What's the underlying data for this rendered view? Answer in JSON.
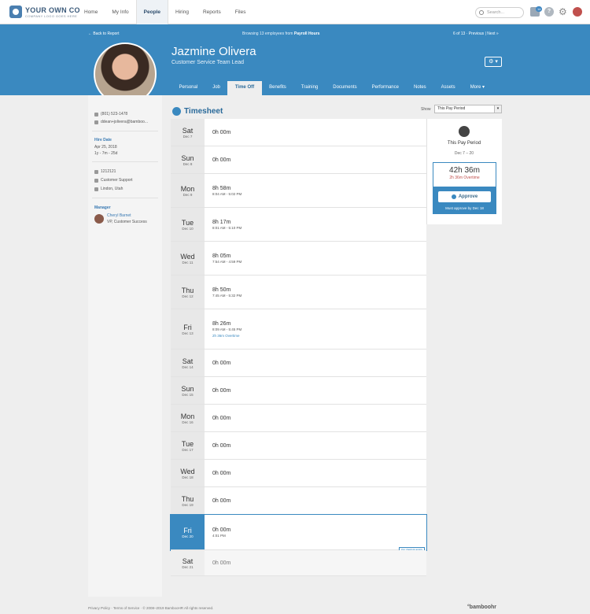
{
  "brand": {
    "name": "YOUR OWN CO",
    "tagline": "COMPANY LOGO GOES HERE"
  },
  "nav": [
    {
      "label": "Home"
    },
    {
      "label": "My Info"
    },
    {
      "label": "People",
      "active": true
    },
    {
      "label": "Hiring"
    },
    {
      "label": "Reports"
    },
    {
      "label": "Files"
    }
  ],
  "search": {
    "placeholder": "Search..."
  },
  "inbox_count": "14",
  "help_label": "?",
  "header": {
    "back": "← Back to Report",
    "browsing_prefix": "Browsing 13 employees from",
    "browsing_source": "Payroll Hours",
    "pager": "6 of 13 · Previous | Next »",
    "name": "Jazmine Olivera",
    "title": "Customer Service Team Lead"
  },
  "tabs": [
    "Personal",
    "Job",
    "Time Off",
    "Benefits",
    "Training",
    "Documents",
    "Performance",
    "Notes",
    "Assets",
    "More ▾"
  ],
  "sidebar": {
    "phone": "(801) 523-1478",
    "email": "ddean+jolivera@bamboo...",
    "hire_label": "Hire Date",
    "hire_date": "Apr 25, 2018",
    "tenure": "1y - 7m - 25d",
    "emp_id": "1212121",
    "department": "Customer Support",
    "location": "Lindon, Utah",
    "manager_label": "Manager",
    "manager_name": "Cheryl Barnet",
    "manager_title": "VP, Customer Success"
  },
  "timesheet": {
    "title": "Timesheet",
    "show_label": "Show",
    "period_select": "This Pay Period",
    "days": [
      {
        "day": "Sat",
        "date": "Dec 7",
        "hours": "0h 00m"
      },
      {
        "day": "Sun",
        "date": "Dec 8",
        "hours": "0h 00m"
      },
      {
        "day": "Mon",
        "date": "Dec 9",
        "hours": "8h 58m",
        "range": "8:04 AM - 5:02 PM"
      },
      {
        "day": "Tue",
        "date": "Dec 10",
        "hours": "8h 17m",
        "range": "8:01 AM - 5:10 PM"
      },
      {
        "day": "Wed",
        "date": "Dec 11",
        "hours": "8h 05m",
        "range": "7:54 AM - 4:59 PM"
      },
      {
        "day": "Thu",
        "date": "Dec 12",
        "hours": "8h 50m",
        "range": "7:45 AM - 5:32 PM"
      },
      {
        "day": "Fri",
        "date": "Dec 13",
        "hours": "8h 26m",
        "range": "8:09 AM - 5:45 PM",
        "overtime": "2h 36m Overtime"
      },
      {
        "day": "Sat",
        "date": "Dec 14",
        "hours": "0h 00m"
      },
      {
        "day": "Sun",
        "date": "Dec 15",
        "hours": "0h 00m"
      },
      {
        "day": "Mon",
        "date": "Dec 16",
        "hours": "0h 00m"
      },
      {
        "day": "Tue",
        "date": "Dec 17",
        "hours": "0h 00m"
      },
      {
        "day": "Wed",
        "date": "Dec 18",
        "hours": "0h 00m"
      },
      {
        "day": "Thu",
        "date": "Dec 19",
        "hours": "0h 00m"
      },
      {
        "day": "Fri",
        "date": "Dec 20",
        "hours": "0h 00m",
        "range": "4:01 PM",
        "current": true,
        "tag": "PAY PERIOD ENDS"
      },
      {
        "day": "Sat",
        "date": "Dec 21",
        "hours": "0h 00m",
        "future": true
      }
    ]
  },
  "summary": {
    "title": "This Pay Period",
    "dates": "Dec 7 – 20",
    "total": "42h 36m",
    "overtime": "2h 36m Overtime",
    "approve": "Approve",
    "must": "Must approve by Dec 18"
  },
  "footer": {
    "text": "Privacy Policy · Terms of Service · © 2008–2019 BambooHR All rights reserved.",
    "logo": "°bamboohr"
  }
}
